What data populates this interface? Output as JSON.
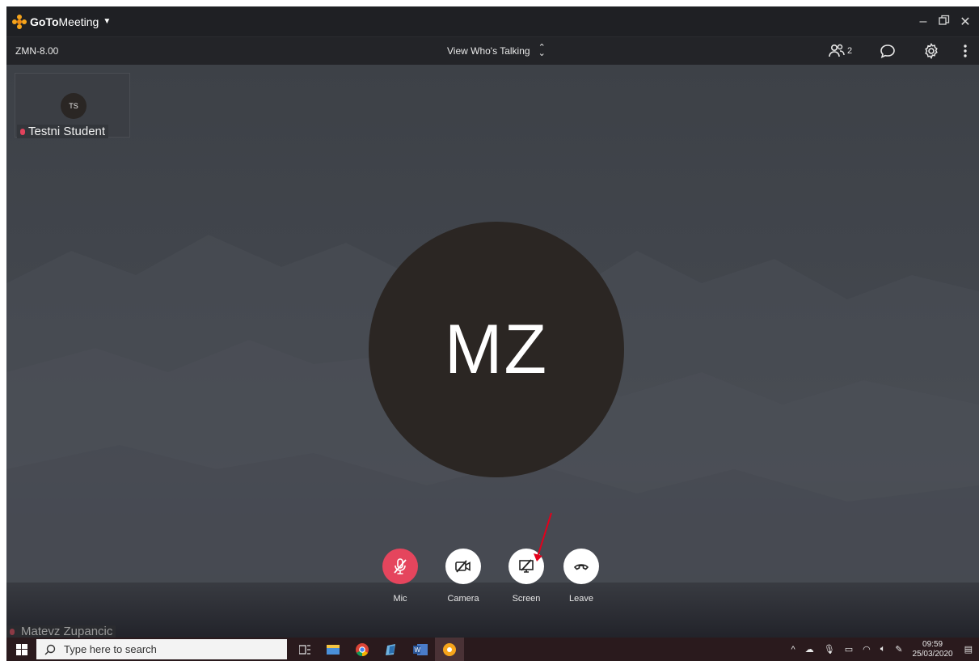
{
  "app": {
    "brand_bold": "GoTo",
    "brand_rest": "Meeting",
    "window_controls": [
      "minimize-icon",
      "restore-icon",
      "close-icon"
    ]
  },
  "toolbar": {
    "session_id": "ZMN-8.00",
    "view_mode": "View Who's Talking",
    "participant_count": "2",
    "icons": [
      "people-icon",
      "chat-icon",
      "gear-icon",
      "more-vertical-icon"
    ]
  },
  "stage": {
    "thumbnail": {
      "initials": "TS",
      "name": "Testni Student"
    },
    "active_speaker_initials": "MZ",
    "self_name": "Matevz Zupancic"
  },
  "controls": {
    "mic_label": "Mic",
    "camera_label": "Camera",
    "screen_label": "Screen",
    "leave_label": "Leave"
  },
  "taskbar": {
    "search_placeholder": "Type here to search",
    "time": "09:59",
    "date": "25/03/2020"
  },
  "colors": {
    "brand_orange": "#f6a41b",
    "mic_muted_red": "#e5455d",
    "annotation_arrow": "#e3001b"
  }
}
